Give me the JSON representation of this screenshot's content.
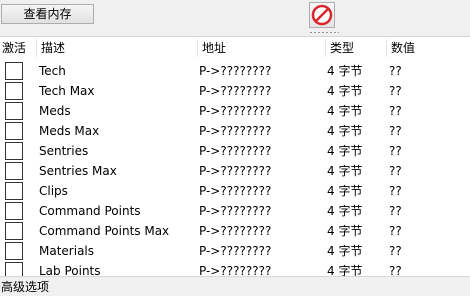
{
  "toolbar": {
    "view_memory_label": "查看内存",
    "stop_icon": "no-entry-icon",
    "stop_color": "#d9262c"
  },
  "table": {
    "headers": {
      "active": "激活",
      "description": "描述",
      "address": "地址",
      "type": "类型",
      "value": "数值"
    },
    "rows": [
      {
        "active": false,
        "description": "Tech",
        "address": "P->????????",
        "type": "4 字节",
        "value": "??"
      },
      {
        "active": false,
        "description": "Tech Max",
        "address": "P->????????",
        "type": "4 字节",
        "value": "??"
      },
      {
        "active": false,
        "description": "Meds",
        "address": "P->????????",
        "type": "4 字节",
        "value": "??"
      },
      {
        "active": false,
        "description": "Meds Max",
        "address": "P->????????",
        "type": "4 字节",
        "value": "??"
      },
      {
        "active": false,
        "description": "Sentries",
        "address": "P->????????",
        "type": "4 字节",
        "value": "??"
      },
      {
        "active": false,
        "description": "Sentries Max",
        "address": "P->????????",
        "type": "4 字节",
        "value": "??"
      },
      {
        "active": false,
        "description": "Clips",
        "address": "P->????????",
        "type": "4 字节",
        "value": "??"
      },
      {
        "active": false,
        "description": "Command Points",
        "address": "P->????????",
        "type": "4 字节",
        "value": "??"
      },
      {
        "active": false,
        "description": "Command Points Max",
        "address": "P->????????",
        "type": "4 字节",
        "value": "??"
      },
      {
        "active": false,
        "description": "Materials",
        "address": "P->????????",
        "type": "4 字节",
        "value": "??"
      },
      {
        "active": false,
        "description": "Lab Points",
        "address": "P->????????",
        "type": "4 字节",
        "value": "??"
      }
    ]
  },
  "footer": {
    "advanced_label": "高级选项"
  }
}
